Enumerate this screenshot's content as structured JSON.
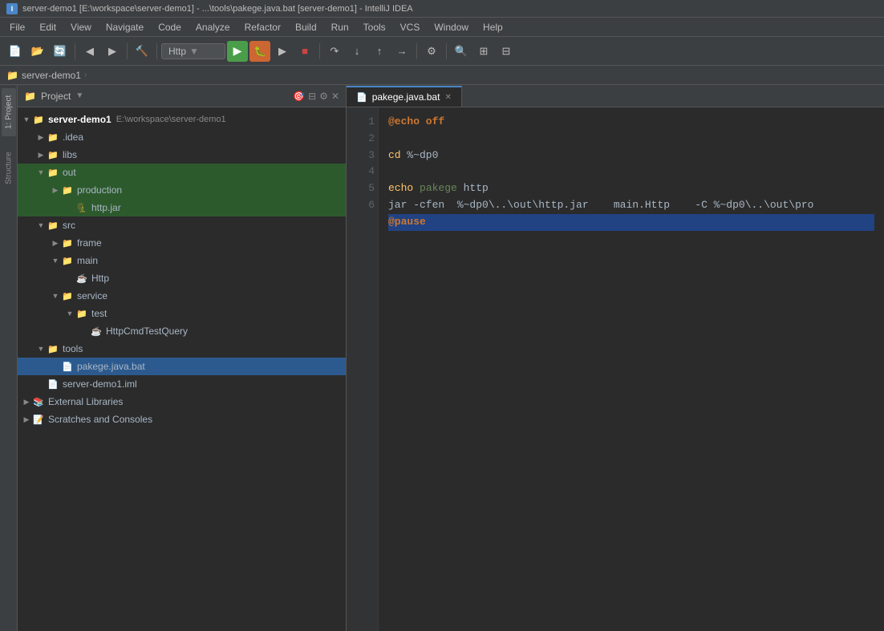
{
  "titleBar": {
    "text": "server-demo1 [E:\\workspace\\server-demo1] - ...\\tools\\pakege.java.bat [server-demo1] - IntelliJ IDEA"
  },
  "menuBar": {
    "items": [
      "File",
      "Edit",
      "View",
      "Navigate",
      "Code",
      "Analyze",
      "Refactor",
      "Build",
      "Run",
      "Tools",
      "VCS",
      "Window",
      "Help"
    ]
  },
  "toolbar": {
    "dropdownLabel": "Http"
  },
  "breadcrumb": {
    "items": [
      "server-demo1"
    ]
  },
  "projectPanel": {
    "headerLabel": "Project",
    "tree": {
      "root": {
        "name": "server-demo1",
        "path": "E:\\workspace\\server-demo1",
        "expanded": true,
        "children": [
          {
            "name": ".idea",
            "type": "folder",
            "expanded": false,
            "indent": 1
          },
          {
            "name": "libs",
            "type": "folder",
            "expanded": false,
            "indent": 1
          },
          {
            "name": "out",
            "type": "folder",
            "expanded": true,
            "indent": 1,
            "children": [
              {
                "name": "production",
                "type": "folder-brown",
                "expanded": false,
                "indent": 2
              },
              {
                "name": "http.jar",
                "type": "jar",
                "indent": 3
              }
            ]
          },
          {
            "name": "src",
            "type": "folder-src",
            "expanded": true,
            "indent": 1,
            "children": [
              {
                "name": "frame",
                "type": "folder",
                "expanded": false,
                "indent": 2
              },
              {
                "name": "main",
                "type": "folder",
                "expanded": true,
                "indent": 2,
                "children": [
                  {
                    "name": "Http",
                    "type": "java",
                    "indent": 3
                  }
                ]
              },
              {
                "name": "service",
                "type": "folder",
                "expanded": true,
                "indent": 2,
                "children": [
                  {
                    "name": "test",
                    "type": "folder",
                    "expanded": true,
                    "indent": 3,
                    "children": [
                      {
                        "name": "HttpCmdTestQuery",
                        "type": "java",
                        "indent": 4
                      }
                    ]
                  }
                ]
              }
            ]
          },
          {
            "name": "tools",
            "type": "folder",
            "expanded": true,
            "indent": 1,
            "children": [
              {
                "name": "pakege.java.bat",
                "type": "bat",
                "indent": 2
              }
            ]
          },
          {
            "name": "server-demo1.iml",
            "type": "iml",
            "indent": 1
          },
          {
            "name": "External Libraries",
            "type": "ext-libs",
            "expanded": false,
            "indent": 0
          },
          {
            "name": "Scratches and Consoles",
            "type": "scratches",
            "expanded": false,
            "indent": 0
          }
        ]
      }
    }
  },
  "editor": {
    "tabs": [
      {
        "label": "pakege.java.bat",
        "active": true
      }
    ],
    "lineNumbers": [
      "1",
      "2",
      "3",
      "4",
      "5",
      "6"
    ],
    "lines": [
      {
        "content": "@echo off",
        "tokens": [
          {
            "text": "@echo off",
            "class": "kw"
          }
        ]
      },
      {
        "content": "",
        "tokens": []
      },
      {
        "content": "cd %~dp0",
        "tokens": [
          {
            "text": "cd ",
            "class": "cmd"
          },
          {
            "text": "%~dp0",
            "class": "var"
          }
        ]
      },
      {
        "content": "echo pakege http",
        "tokens": [
          {
            "text": "echo ",
            "class": "cmd"
          },
          {
            "text": "pakege",
            "class": "str"
          },
          {
            "text": " http",
            "class": "var"
          }
        ]
      },
      {
        "content": "jar -cfen  %~dp0\\..\\out\\http.jar    main.Http    -C %~dp0\\..\\out\\pro",
        "tokens": [
          {
            "text": "jar -cfen  %~dp0\\..\\out\\http.jar    main.Http    -C %~dp0\\..\\out\\pro",
            "class": "var"
          }
        ]
      },
      {
        "content": "@pause",
        "tokens": [
          {
            "text": "@pause",
            "class": "kw selected-line"
          }
        ],
        "selected": true
      }
    ]
  },
  "sideLabels": {
    "project": "1: Project",
    "structure": "Structure"
  }
}
